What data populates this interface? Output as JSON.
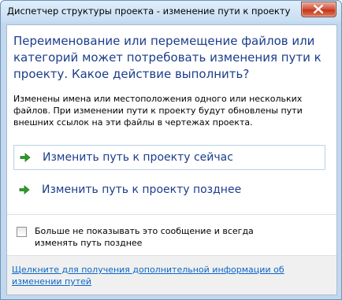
{
  "window": {
    "title": "Диспетчер структуры проекта - изменение пути к проекту"
  },
  "dialog": {
    "main_instruction": "Переименование или перемещение файлов или категорий может потребовать изменения пути к проекту. Какое действие выполнить?",
    "content": "Изменены имена или местоположения одного или нескольких файлов. При изменении пути к проекту будут обновлены пути внешних ссылок на эти файлы в чертежах проекта.",
    "commands": [
      {
        "label": "Изменить путь к проекту сейчас",
        "icon": "green-arrow-icon",
        "selected": true
      },
      {
        "label": "Изменить путь к проекту позднее",
        "icon": "green-arrow-icon",
        "selected": false
      }
    ],
    "verification": {
      "label": "Больше не показывать это сообщение и всегда изменять путь позднее",
      "checked": false
    },
    "footer_link": "Щелкните для получения дополнительной информации об изменении путей"
  },
  "colors": {
    "instruction": "#1c3d8c",
    "link": "#0b66c6",
    "arrow": "#2e9b2e"
  }
}
